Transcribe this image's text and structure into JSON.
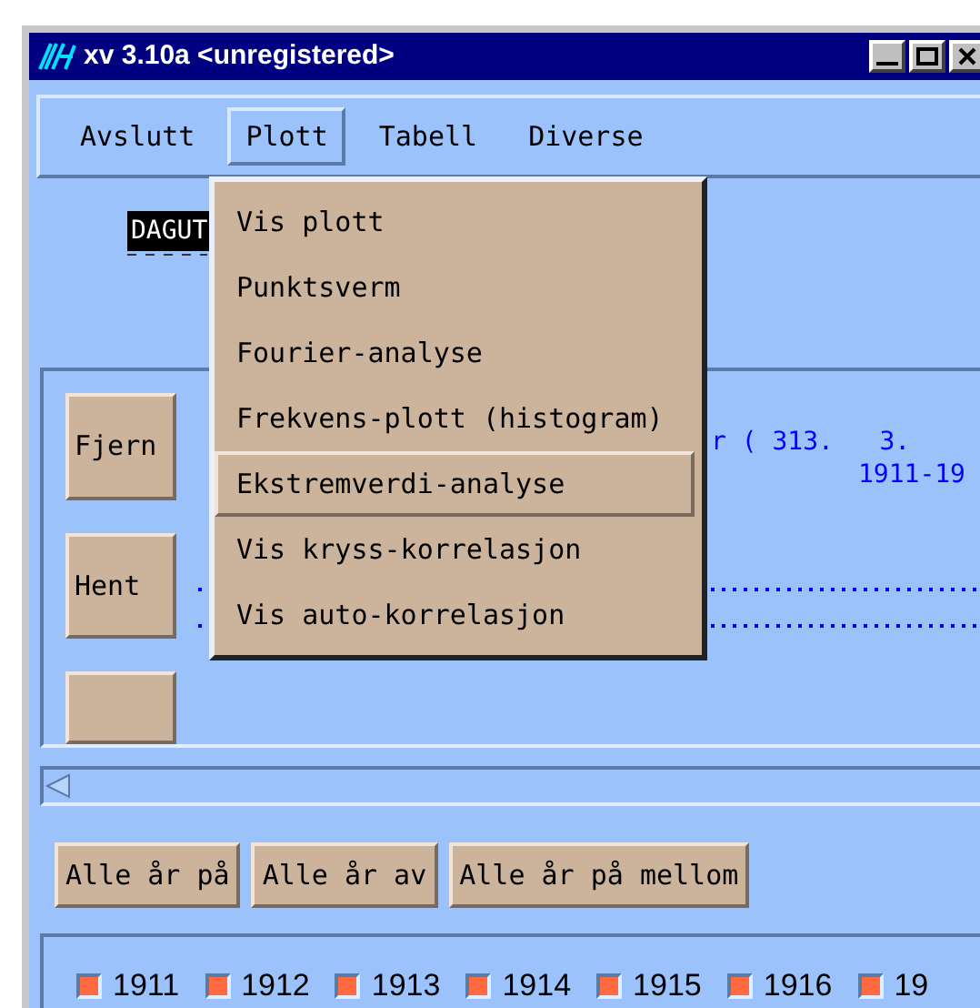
{
  "window": {
    "title": "xv 3.10a <unregistered>"
  },
  "menu_bar": [
    {
      "label": "Avslutt",
      "selected": false
    },
    {
      "label": "Plott",
      "selected": true
    },
    {
      "label": "Tabell",
      "selected": false
    },
    {
      "label": "Diverse",
      "selected": false
    }
  ],
  "menu": {
    "items": [
      {
        "label": "Vis plott",
        "selected": false
      },
      {
        "label": "Punktsverm",
        "selected": false
      },
      {
        "label": "Fourier-analyse",
        "selected": false
      },
      {
        "label": "Frekvens-plott (histogram)",
        "selected": false
      },
      {
        "label": "Ekstremverdi-analyse",
        "selected": true
      },
      {
        "label": "Vis kryss-korrelasjon",
        "selected": false
      },
      {
        "label": "Vis auto-korrelasjon",
        "selected": false
      }
    ]
  },
  "station_label": "DAGUT",
  "panel": {
    "buttons": [
      "Fjern",
      "Hent"
    ],
    "info_lines": [
      "r ( 313.   3.",
      "1911-19"
    ]
  },
  "year_buttons": [
    "Alle år på",
    "Alle år av",
    "Alle år på mellom"
  ],
  "years": [
    {
      "label": "1911",
      "checked": true
    },
    {
      "label": "1912",
      "checked": true
    },
    {
      "label": "1913",
      "checked": true
    },
    {
      "label": "1914",
      "checked": true
    },
    {
      "label": "1915",
      "checked": true
    },
    {
      "label": "1916",
      "checked": true
    },
    {
      "label": "19",
      "checked": true
    }
  ]
}
